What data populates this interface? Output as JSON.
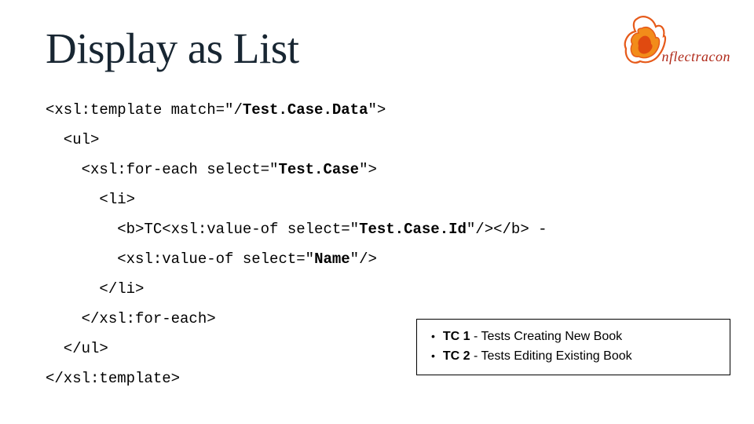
{
  "title": "Display as List",
  "logo": {
    "brand": "nflectracon"
  },
  "code": {
    "l1a": "<xsl:template match=\"/",
    "l1b": "Test.Case.Data",
    "l1c": "\">",
    "l2": "  <ul>",
    "l3a": "    <xsl:for-each select=\"",
    "l3b": "Test.Case",
    "l3c": "\">",
    "l4": "      <li>",
    "l5a": "        <b>TC<xsl:value-of select=\"",
    "l5b": "Test.Case.Id",
    "l5c": "\"/></b> -",
    "l6a": "        <xsl:value-of select=\"",
    "l6b": "Name",
    "l6c": "\"/>",
    "l7": "      </li>",
    "l8": "    </xsl:for-each>",
    "l9": "  </ul>",
    "l10": "</xsl:template>"
  },
  "output": {
    "items": [
      {
        "id": "TC 1",
        "sep": " - ",
        "name": "Tests Creating New Book"
      },
      {
        "id": "TC 2",
        "sep": " - ",
        "name": "Tests Editing Existing Book"
      }
    ]
  }
}
